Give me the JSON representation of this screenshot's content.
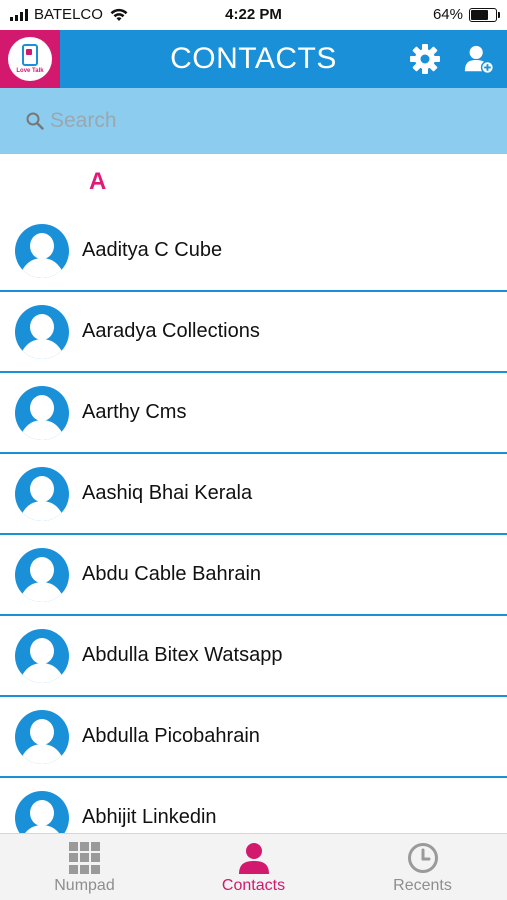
{
  "status_bar": {
    "carrier": "BATELCO",
    "time": "4:22 PM",
    "battery": "64%",
    "battery_level": 0.64
  },
  "header": {
    "title": "CONTACTS",
    "logo_text": "Love Talk",
    "icons": [
      "settings-gear-icon",
      "add-user-icon"
    ]
  },
  "search": {
    "placeholder": "Search",
    "value": ""
  },
  "section_letter": "A",
  "contacts": [
    "Aaditya C Cube",
    "Aaradya Collections",
    "Aarthy Cms",
    "Aashiq Bhai Kerala",
    "Abdu Cable Bahrain",
    "Abdulla Bitex Watsapp",
    "Abdulla Picobahrain",
    "Abhijit Linkedin"
  ],
  "tabs": [
    {
      "label": "Numpad",
      "icon": "numpad-grid-icon",
      "active": false
    },
    {
      "label": "Contacts",
      "icon": "person-icon",
      "active": true
    },
    {
      "label": "Recents",
      "icon": "clock-icon",
      "active": false
    }
  ],
  "colors": {
    "primary_blue": "#1a90d9",
    "search_bg": "#8ccdef",
    "accent_pink": "#d2196e",
    "section_pink": "#e0197a"
  }
}
